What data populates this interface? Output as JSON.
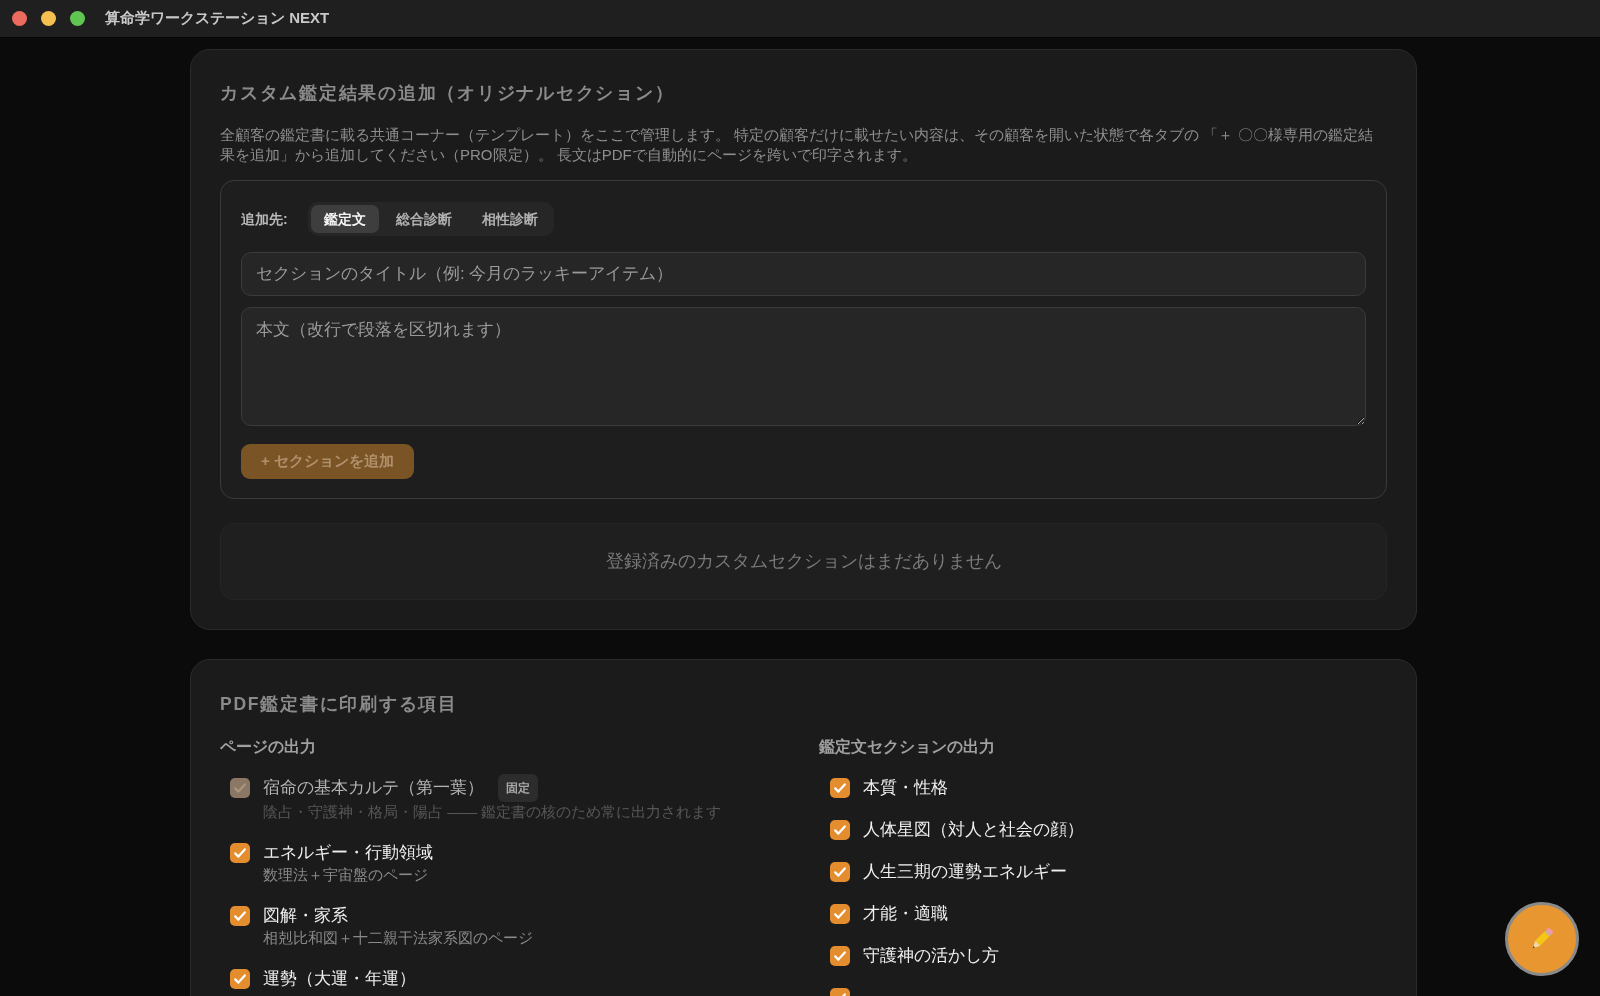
{
  "window": {
    "title": "算命学ワークステーション NEXT"
  },
  "custom_section": {
    "title": "カスタム鑑定結果の追加（オリジナルセクション）",
    "description": "全顧客の鑑定書に載る共通コーナー（テンプレート）をここで管理します。 特定の顧客だけに載せたい内容は、その顧客を開いた状態で各タブの 「＋ 〇〇様専用の鑑定結果を追加」から追加してください（PRO限定）。 長文はPDFで自動的にページを跨いで印字されます。",
    "form": {
      "target_label": "追加先:",
      "tabs": [
        {
          "label": "鑑定文",
          "selected": true
        },
        {
          "label": "総合診断",
          "selected": false
        },
        {
          "label": "相性診断",
          "selected": false
        }
      ],
      "title_field": {
        "placeholder": "セクションのタイトル（例: 今月のラッキーアイテム）"
      },
      "body_field": {
        "placeholder": "本文（改行で段落を区切れます）"
      },
      "add_button": {
        "label": "+ セクションを追加",
        "disabled": true
      }
    },
    "empty_message": "登録済みのカスタムセクションはまだありません"
  },
  "print_items": {
    "title": "PDF鑑定書に印刷する項目",
    "columns": [
      {
        "heading": "ページの出力",
        "items": [
          {
            "label": "宿命の基本カルテ（第一葉）",
            "badge": "固定",
            "sub": "陰占・守護神・格局・陽占 —— 鑑定書の核のため常に出力されます",
            "checked": true,
            "disabled": true
          },
          {
            "label": "エネルギー・行動領域",
            "sub": "数理法＋宇宙盤のページ",
            "checked": true,
            "disabled": false
          },
          {
            "label": "図解・家系",
            "sub": "相剋比和図＋十二親干法家系図のページ",
            "checked": true,
            "disabled": false
          },
          {
            "label": "運勢（大運・年運）",
            "checked": true,
            "disabled": false
          }
        ]
      },
      {
        "heading": "鑑定文セクションの出力",
        "items": [
          {
            "label": "本質・性格",
            "checked": true,
            "disabled": false
          },
          {
            "label": "人体星図（対人と社会の顔）",
            "checked": true,
            "disabled": false
          },
          {
            "label": "人生三期の運勢エネルギー",
            "checked": true,
            "disabled": false
          },
          {
            "label": "才能・適職",
            "checked": true,
            "disabled": false
          },
          {
            "label": "守護神の活かし方",
            "checked": true,
            "disabled": false
          },
          {
            "checked": true,
            "disabled": false
          }
        ]
      }
    ]
  }
}
